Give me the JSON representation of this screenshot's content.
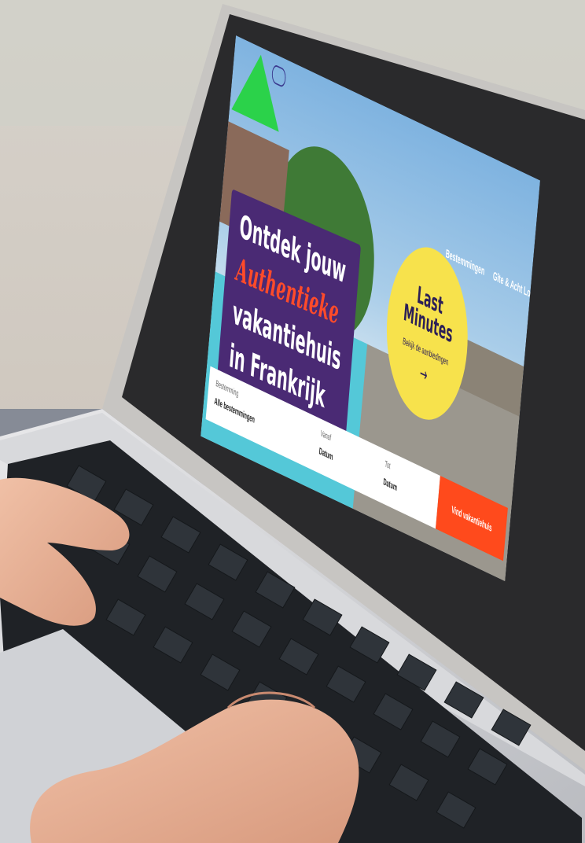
{
  "site": {
    "logo_icon": "triangle-logo-icon",
    "nav": [
      "Bestemmingen",
      "Gîte & Acht Logo"
    ],
    "hero_lines": [
      "Ontdek jouw",
      "Authentieke",
      "vakantiehuis",
      "in Frankrijk"
    ],
    "badge": {
      "title_line1": "Last",
      "title_line2": "Minutes",
      "subtitle": "Bekijk de aanbiedingen",
      "arrow": "→"
    },
    "search": {
      "field1_label": "Bestemming",
      "field1_value": "Alle bestemmingen",
      "field2_label": "Vanaf",
      "field2_value": "Datum",
      "field3_label": "Tot",
      "field3_value": "Datum",
      "button_label": "Vind vakantiehuis"
    }
  },
  "colors": {
    "accent_green": "#2bd24a",
    "hero_purple": "#4a2a74",
    "badge_yellow": "#f7e24c",
    "cta_orange": "#ff4a1c"
  }
}
